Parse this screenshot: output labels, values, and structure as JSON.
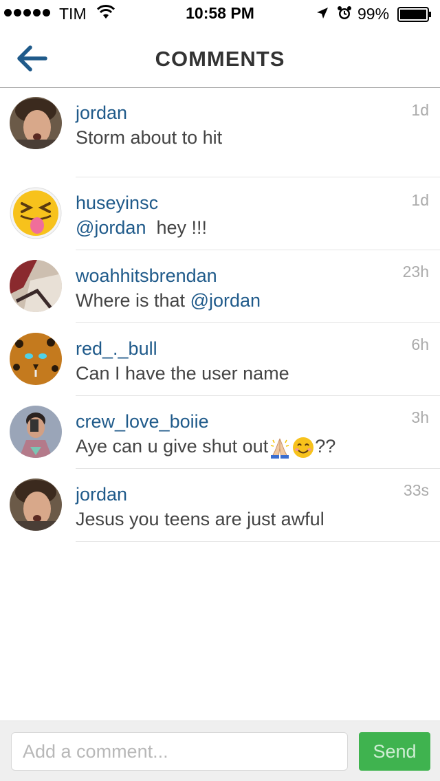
{
  "status_bar": {
    "carrier": "TIM",
    "time": "10:58 PM",
    "battery": "99%",
    "signal_bars": 5
  },
  "nav": {
    "title": "COMMENTS",
    "back_icon": "arrow-left-icon"
  },
  "colors": {
    "accent": "#1f5a8a",
    "send_bg": "#3fb34f",
    "time_text": "#aaaaaa"
  },
  "comments": [
    {
      "username": "jordan",
      "text": "Storm about to hit",
      "time": "1d"
    },
    {
      "username": "huseyinsc",
      "mention": "@jordan",
      "text": "hey !!!",
      "time": "1d"
    },
    {
      "username": "woahhitsbrendan",
      "text": "Where is that",
      "mention": "@jordan",
      "time": "23h"
    },
    {
      "username": "red_._bull",
      "text": "Can I have the user name",
      "time": "6h"
    },
    {
      "username": "crew_love_boiie",
      "text": "Aye can u give shut out",
      "suffix": "??",
      "time": "3h"
    },
    {
      "username": "jordan",
      "text": "Jesus you teens are just awful",
      "time": "33s"
    }
  ],
  "composer": {
    "placeholder": "Add a comment...",
    "send_label": "Send"
  }
}
